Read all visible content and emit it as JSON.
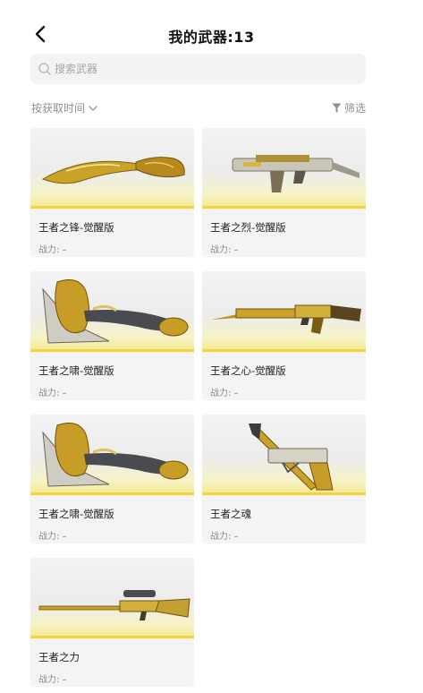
{
  "header": {
    "title": "我的武器:13",
    "back_icon": "chevron-left-icon"
  },
  "search": {
    "placeholder": "搜索武器",
    "value": ""
  },
  "toolbar": {
    "sort_label": "按获取时间",
    "filter_label": "筛选"
  },
  "weapons": [
    {
      "name": "王者之锋-觉醒版",
      "power": "战力: –",
      "kind": "knife"
    },
    {
      "name": "王者之烈-觉醒版",
      "power": "战力: –",
      "kind": "smg"
    },
    {
      "name": "王者之啸-觉醒版",
      "power": "战力: –",
      "kind": "axe"
    },
    {
      "name": "王者之心-觉醒版",
      "power": "战力: –",
      "kind": "rifle"
    },
    {
      "name": "王者之啸-觉醒版",
      "power": "战力: –",
      "kind": "axe"
    },
    {
      "name": "王者之魂",
      "power": "战力: –",
      "kind": "pistol-knife"
    },
    {
      "name": "王者之力",
      "power": "战力: –",
      "kind": "sniper"
    }
  ],
  "colors": {
    "accent_gold": "#f3d23a",
    "card_bg": "#f4f4f6",
    "search_bg": "#f3f3f5"
  }
}
